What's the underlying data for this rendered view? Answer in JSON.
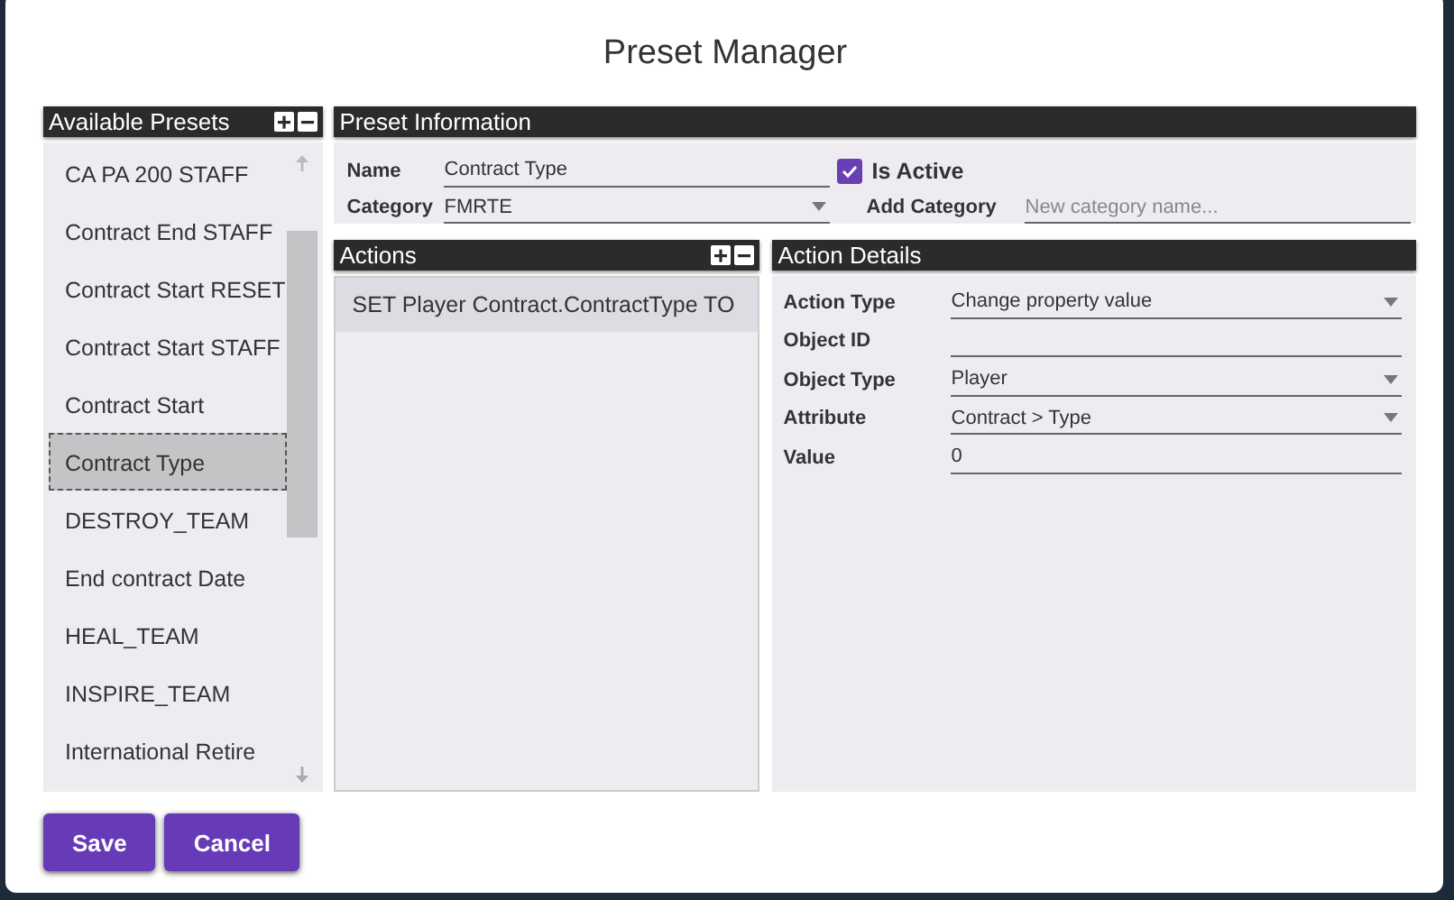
{
  "window": {
    "title": "Preset Manager"
  },
  "presets": {
    "title": "Available Presets",
    "items": [
      {
        "label": "CA PA 200 STAFF",
        "selected": false
      },
      {
        "label": "Contract End STAFF",
        "selected": false
      },
      {
        "label": "Contract Start RESET",
        "selected": false
      },
      {
        "label": "Contract Start STAFF",
        "selected": false
      },
      {
        "label": "Contract Start",
        "selected": false
      },
      {
        "label": "Contract Type",
        "selected": true
      },
      {
        "label": "DESTROY_TEAM",
        "selected": false
      },
      {
        "label": "End contract Date",
        "selected": false
      },
      {
        "label": "HEAL_TEAM",
        "selected": false
      },
      {
        "label": "INSPIRE_TEAM",
        "selected": false
      },
      {
        "label": "International Retire",
        "selected": false
      }
    ]
  },
  "preset_information": {
    "title": "Preset Information",
    "name": {
      "label": "Name",
      "value": "Contract Type"
    },
    "is_active": {
      "label": "Is Active",
      "checked": true
    },
    "category": {
      "label": "Category",
      "value": "FMRTE"
    },
    "add_category": {
      "label": "Add Category",
      "placeholder": "New category name..."
    }
  },
  "actions": {
    "title": "Actions",
    "items": [
      {
        "label": "SET Player Contract.ContractType TO",
        "selected": true
      }
    ]
  },
  "action_details": {
    "title": "Action Details",
    "fields": [
      {
        "label": "Action Type",
        "value": "Change property value",
        "kind": "dropdown"
      },
      {
        "label": "Object ID",
        "kind": "text"
      },
      {
        "label": "Object Type",
        "value": "Player",
        "kind": "dropdown"
      },
      {
        "label": "Attribute",
        "value": "Contract > Type",
        "kind": "dropdown"
      },
      {
        "label": "Value",
        "value": "0",
        "kind": "text"
      }
    ]
  },
  "buttons": [
    "Save",
    "Cancel"
  ]
}
